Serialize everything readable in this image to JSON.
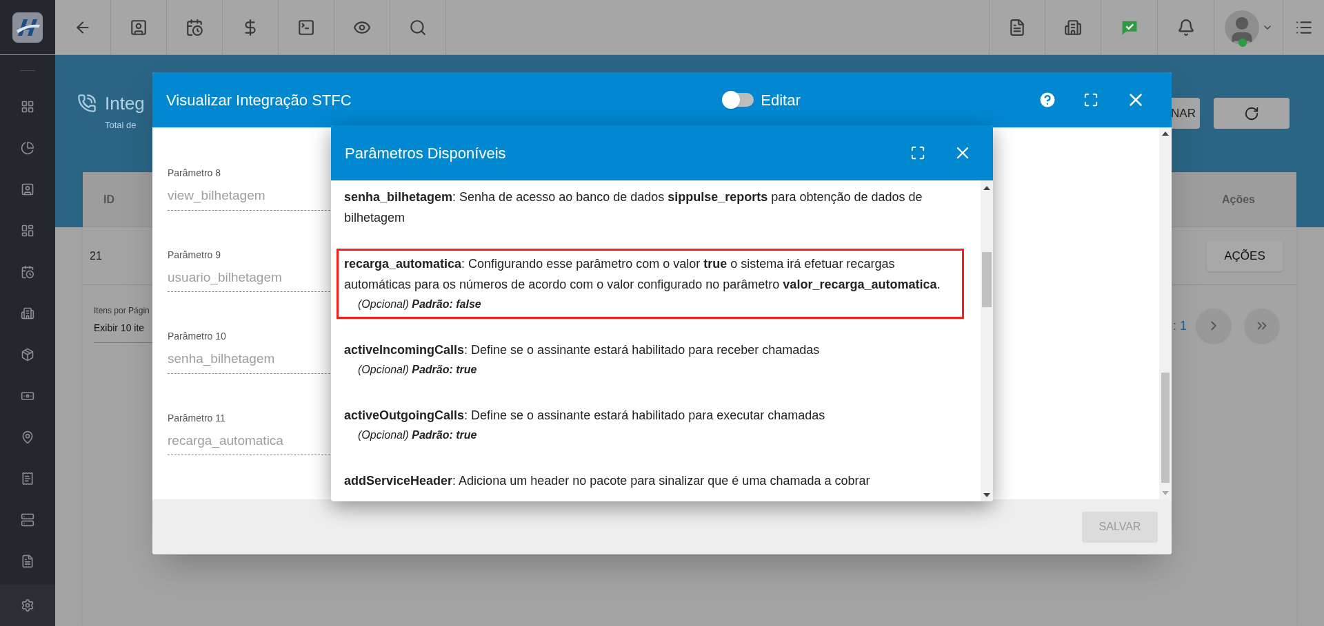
{
  "page": {
    "title": "Integ",
    "subtitle": "Total de",
    "buttons": [
      {
        "label": "NAR"
      }
    ],
    "table": {
      "columns": [
        "ID",
        "Ações"
      ],
      "rows": [
        {
          "id": "21",
          "action": "AÇÕES"
        }
      ]
    },
    "pagination": {
      "per_page_label": "Itens por Págin",
      "per_page_value": "Exibir 10 ite",
      "page_text": ": 1"
    }
  },
  "dialog": {
    "title": "Visualizar Integração STFC",
    "edit_toggle": {
      "label": "Editar",
      "on": false
    },
    "fields": [
      {
        "label": "Parâmetro 8",
        "value": "view_bilhetagem"
      },
      {
        "label": "Parâmetro 9",
        "value": "usuario_bilhetagem"
      },
      {
        "label": "Parâmetro 10",
        "value": "senha_bilhetagem"
      },
      {
        "label": "Parâmetro 11",
        "value": "recarga_automatica"
      }
    ],
    "save_button": {
      "label": "SALVAR",
      "disabled": true
    }
  },
  "params_dialog": {
    "title": "Parâmetros Disponíveis",
    "entries": [
      {
        "text": "**senha_bilhetagem**: Senha de acesso ao banco de dados **sippulse_reports** para obtenção de dados de bilhetagem",
        "highlighted": false
      },
      {
        "text": "**recarga_automatica**: Configurando esse parâmetro com o valor **true** o sistema irá efetuar recargas automáticas para os números de acordo com o valor configurado no parâmetro **valor_recarga_automatica**.",
        "note": "(Opcional) **Padrão: false**",
        "highlighted": true
      },
      {
        "text": "**activeIncomingCalls**: Define se o assinante estará habilitado para receber chamadas",
        "note": "(Opcional) **Padrão: true**",
        "highlighted": false
      },
      {
        "text": "**activeOutgoingCalls**: Define se o assinante estará habilitado para executar chamadas",
        "note": "(Opcional) **Padrão: true**",
        "highlighted": false
      },
      {
        "text": "**addServiceHeader**: Adiciona um header no pacote para sinalizar que é uma chamada a cobrar",
        "highlighted": false
      }
    ]
  }
}
